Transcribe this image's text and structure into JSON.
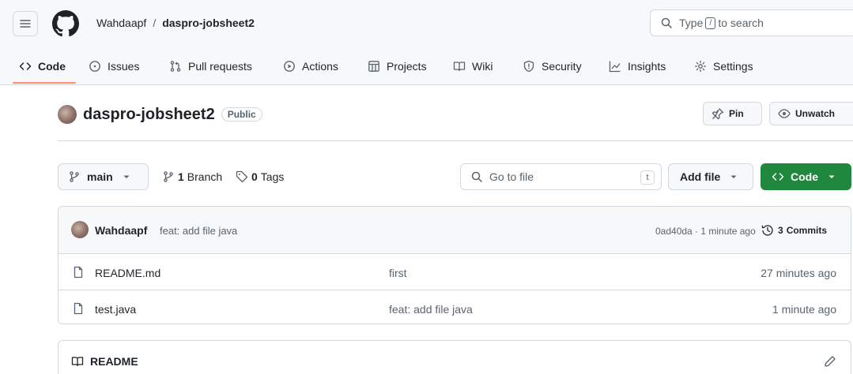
{
  "header": {
    "owner": "Wahdaapf",
    "separator": "/",
    "repo": "daspro-jobsheet2",
    "search": {
      "prefix": "Type",
      "key": "/",
      "suffix": "to search"
    }
  },
  "nav": {
    "tabs": [
      {
        "label": "Code",
        "icon": "code-icon",
        "active": true
      },
      {
        "label": "Issues",
        "icon": "issue-icon"
      },
      {
        "label": "Pull requests",
        "icon": "pull-request-icon"
      },
      {
        "label": "Actions",
        "icon": "play-icon"
      },
      {
        "label": "Projects",
        "icon": "table-icon"
      },
      {
        "label": "Wiki",
        "icon": "book-icon"
      },
      {
        "label": "Security",
        "icon": "shield-icon"
      },
      {
        "label": "Insights",
        "icon": "graph-icon"
      },
      {
        "label": "Settings",
        "icon": "gear-icon"
      }
    ]
  },
  "repo": {
    "name": "daspro-jobsheet2",
    "visibility": "Public",
    "pin_label": "Pin",
    "watch_label": "Unwatch"
  },
  "toolbar": {
    "branch": "main",
    "branch_count": "1",
    "branch_word": "Branch",
    "tag_count": "0",
    "tag_word": "Tags",
    "gofile_placeholder": "Go to file",
    "gofile_key": "t",
    "add_file_label": "Add file",
    "code_label": "Code"
  },
  "commit": {
    "author": "Wahdaapf",
    "message": "feat: add file java",
    "hash_time": "0ad40da · 1 minute ago",
    "commits_count": "3",
    "commits_word": "Commits"
  },
  "files": [
    {
      "name": "README.md",
      "message": "first",
      "time": "27 minutes ago"
    },
    {
      "name": "test.java",
      "message": "feat: add file java",
      "time": "1 minute ago"
    }
  ],
  "readme": {
    "title": "README"
  },
  "colors": {
    "accent_underline": "#fd8c73",
    "code_button": "#1f883d",
    "muted": "#59636e",
    "border": "#d1d9e0"
  }
}
